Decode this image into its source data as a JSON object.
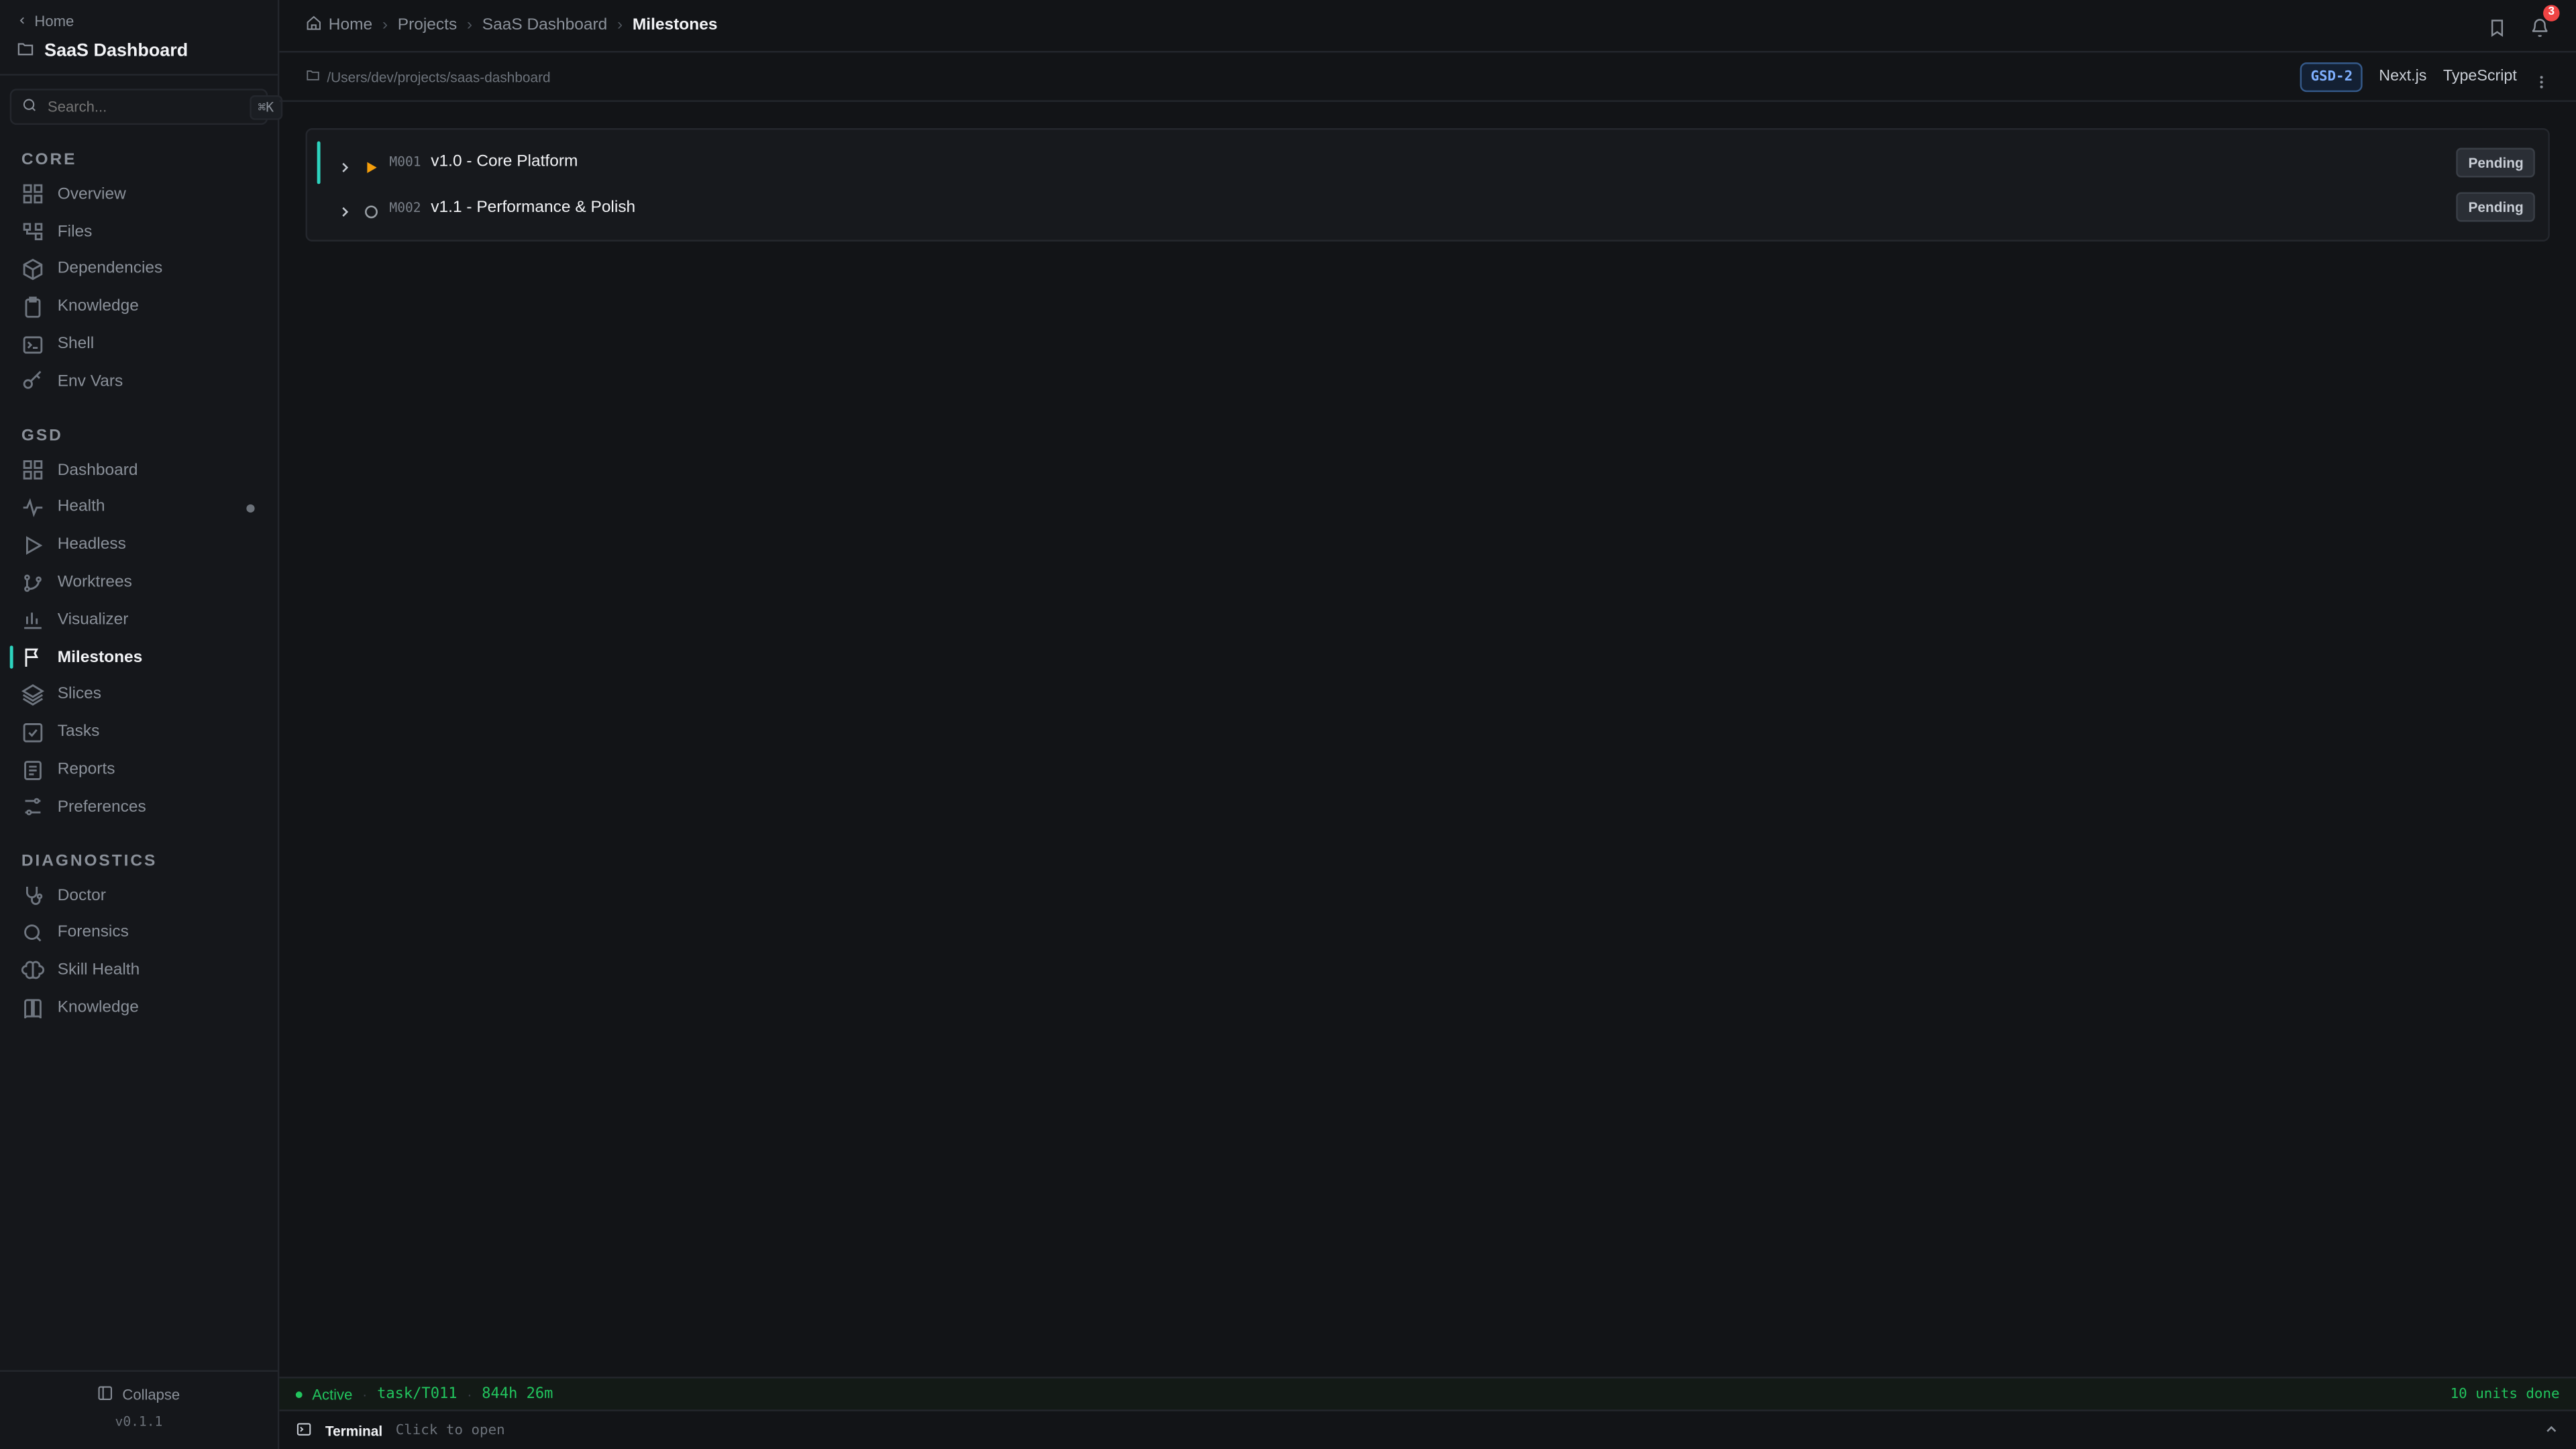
{
  "sidebar": {
    "back_label": "Home",
    "project_name": "SaaS Dashboard",
    "search": {
      "placeholder": "Search...",
      "shortcut": "⌘K"
    },
    "sections": [
      {
        "title": "CORE",
        "items": [
          {
            "label": "Overview",
            "icon": "grid-icon"
          },
          {
            "label": "Files",
            "icon": "folder-tree-icon"
          },
          {
            "label": "Dependencies",
            "icon": "package-icon"
          },
          {
            "label": "Knowledge",
            "icon": "clipboard-icon"
          },
          {
            "label": "Shell",
            "icon": "terminal-icon"
          },
          {
            "label": "Env Vars",
            "icon": "key-icon"
          }
        ]
      },
      {
        "title": "GSD",
        "items": [
          {
            "label": "Dashboard",
            "icon": "grid-icon"
          },
          {
            "label": "Health",
            "icon": "activity-icon"
          },
          {
            "label": "Headless",
            "icon": "play-icon"
          },
          {
            "label": "Worktrees",
            "icon": "git-branch-icon"
          },
          {
            "label": "Visualizer",
            "icon": "bar-chart-icon"
          },
          {
            "label": "Milestones",
            "icon": "flag-icon",
            "active": true
          },
          {
            "label": "Slices",
            "icon": "layers-icon"
          },
          {
            "label": "Tasks",
            "icon": "check-square-icon"
          },
          {
            "label": "Reports",
            "icon": "report-icon"
          },
          {
            "label": "Preferences",
            "icon": "sliders-icon"
          }
        ]
      },
      {
        "title": "DIAGNOSTICS",
        "items": [
          {
            "label": "Doctor",
            "icon": "stethoscope-icon"
          },
          {
            "label": "Forensics",
            "icon": "search-icon"
          },
          {
            "label": "Skill Health",
            "icon": "brain-icon"
          },
          {
            "label": "Knowledge",
            "icon": "book-icon"
          }
        ]
      }
    ],
    "footer": {
      "collapse_label": "Collapse",
      "version": "v0.1.1"
    }
  },
  "topbar": {
    "breadcrumbs": [
      "Home",
      "Projects",
      "SaaS Dashboard",
      "Milestones"
    ],
    "notifications_count": "3"
  },
  "pathbar": {
    "path": "/Users/dev/projects/saas-dashboard",
    "project_id": "GSD-2",
    "tags": [
      "Next.js",
      "TypeScript"
    ]
  },
  "milestones": [
    {
      "id": "M001",
      "title": "v1.0 - Core Platform",
      "status": "Pending",
      "status_icon": "play-icon",
      "accent": "#f59e0b"
    },
    {
      "id": "M002",
      "title": "v1.1 - Performance & Polish",
      "status": "Pending",
      "status_icon": "circle-icon",
      "accent": "#9aa0a6"
    }
  ],
  "statusbar": {
    "state": "Active",
    "task": "task/T011",
    "elapsed": "844h 26m",
    "units_done": "10 units done"
  },
  "terminal": {
    "label": "Terminal",
    "hint": "Click to open"
  },
  "colors": {
    "accent": "#2dd4bf",
    "success": "#22c55e",
    "warning": "#f59e0b",
    "danger": "#ef4444"
  }
}
